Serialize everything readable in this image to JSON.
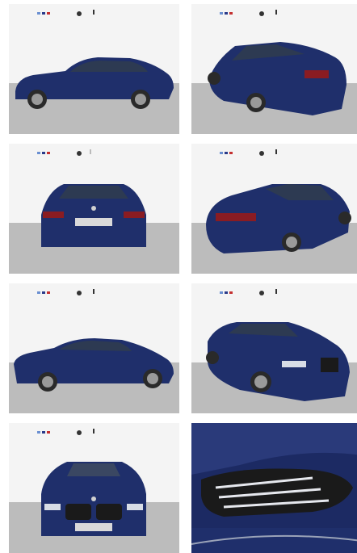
{
  "gallery": {
    "photos": [
      {
        "label": "side-left",
        "car_color": "#1f2f6b",
        "floor_color": "#bdbdbd",
        "wall_color": "#f2f2f2"
      },
      {
        "label": "rear-three-quarter-left",
        "car_color": "#1f2f6b",
        "floor_color": "#bdbdbd",
        "wall_color": "#f2f2f2"
      },
      {
        "label": "rear",
        "car_color": "#1f2f6b",
        "floor_color": "#bdbdbd",
        "wall_color": "#f2f2f2"
      },
      {
        "label": "rear-three-quarter-right",
        "car_color": "#1f2f6b",
        "floor_color": "#bdbdbd",
        "wall_color": "#f2f2f2"
      },
      {
        "label": "side-left-2",
        "car_color": "#1f2f6b",
        "floor_color": "#bdbdbd",
        "wall_color": "#f2f2f2"
      },
      {
        "label": "front-three-quarter-right",
        "car_color": "#1f2f6b",
        "floor_color": "#bdbdbd",
        "wall_color": "#f2f2f2"
      },
      {
        "label": "front",
        "car_color": "#1f2f6b",
        "floor_color": "#bdbdbd",
        "wall_color": "#f2f2f2"
      },
      {
        "label": "headlight-closeup",
        "car_color": "#1f2f6b",
        "floor_color": "#bdbdbd",
        "wall_color": "#f2f2f2"
      }
    ]
  }
}
